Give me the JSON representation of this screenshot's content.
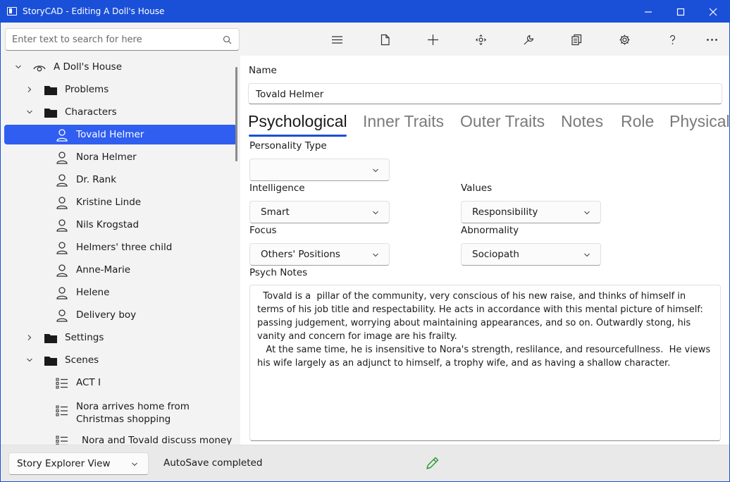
{
  "window": {
    "title": "StoryCAD - Editing A Doll's House"
  },
  "search": {
    "placeholder": "Enter text to search for here"
  },
  "toolbar": {
    "icons": [
      "menu-icon",
      "file-icon",
      "add-icon",
      "move-icon",
      "tools-icon",
      "reports-icon",
      "settings-icon",
      "help-icon",
      "more-icon"
    ]
  },
  "tree": {
    "root": "A Doll's House",
    "problems": "Problems",
    "characters": "Characters",
    "character_list": [
      "Tovald Helmer",
      "Nora Helmer",
      "Dr. Rank",
      "Kristine Linde",
      "Nils Krogstad",
      "Helmers' three child",
      "Anne-Marie",
      "Helene",
      "Delivery boy"
    ],
    "settings": "Settings",
    "scenes": "Scenes",
    "scene_list": [
      "ACT I",
      "Nora arrives home from Christmas shopping",
      "Nora and Tovald discuss money"
    ]
  },
  "form": {
    "name_label": "Name",
    "name_value": "Tovald Helmer",
    "tabs": [
      "Psychological",
      "Inner Traits",
      "Outer Traits",
      "Notes",
      "Role",
      "Physical"
    ],
    "personality_label": "Personality Type",
    "personality_value": "",
    "intelligence_label": "Intelligence",
    "intelligence_value": "Smart",
    "values_label": "Values",
    "values_value": "Responsibility",
    "focus_label": "Focus",
    "focus_value": "Others' Positions",
    "abnormality_label": "Abnormality",
    "abnormality_value": "Sociopath",
    "psych_notes_label": "Psych Notes",
    "psych_notes": "  Tovald is a  pillar of the community, very conscious of his new raise, and thinks of himself in terms of his job title and respectability. He acts in accordance with this mental picture of himself: passing judgement, worrying about maintaining appearances, and so on. Outwardly stong, his vanity and concern for image are his frailty.\n   At the same time, he is insensitive to Nora's strength, reslilance, and resourcefullness.  He views his wife largely as an adjunct to himself, a trophy wife, and as having a shallow character."
  },
  "status": {
    "view": "Story Explorer View",
    "message": "AutoSave completed"
  },
  "colors": {
    "accent": "#1a4fd8",
    "selection": "#2f5ef0",
    "edit_indicator": "#2e9a3a"
  }
}
